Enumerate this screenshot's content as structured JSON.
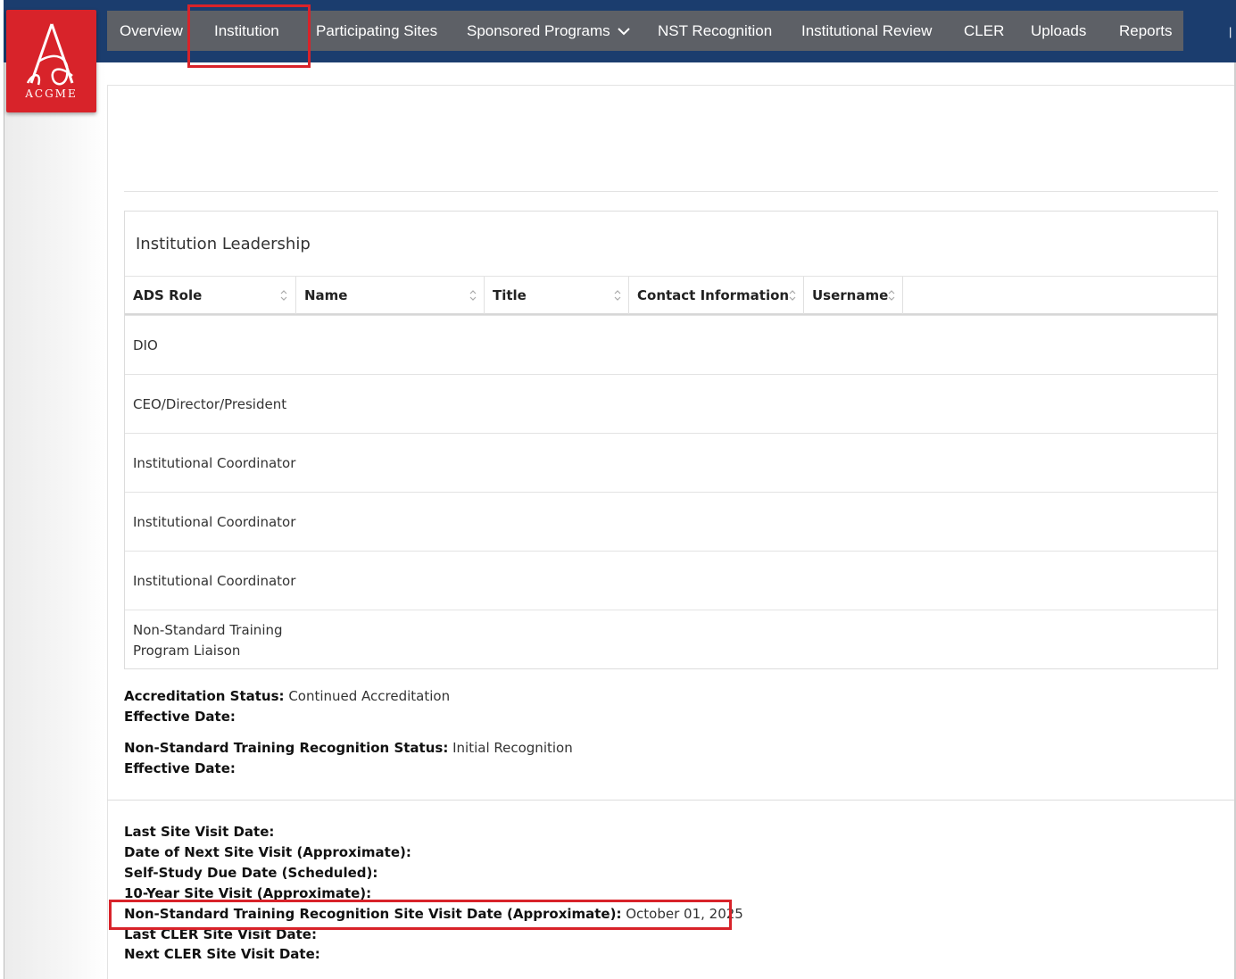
{
  "app": {
    "logo_text": "ACGME"
  },
  "nav": {
    "items": [
      {
        "label": "Overview"
      },
      {
        "label": "Institution"
      },
      {
        "label": "Participating Sites"
      },
      {
        "label": "Sponsored Programs"
      },
      {
        "label": "NST Recognition"
      },
      {
        "label": "Institutional Review"
      },
      {
        "label": "CLER"
      },
      {
        "label": "Uploads"
      },
      {
        "label": "Reports"
      }
    ],
    "active": "Institution"
  },
  "leadership": {
    "title": "Institution Leadership",
    "columns": [
      "ADS Role",
      "Name",
      "Title",
      "Contact Information",
      "Username"
    ],
    "rows": [
      {
        "role": "DIO"
      },
      {
        "role": "CEO/Director/President"
      },
      {
        "role": "Institutional Coordinator"
      },
      {
        "role": "Institutional Coordinator"
      },
      {
        "role": "Institutional Coordinator"
      },
      {
        "role": "Non-Standard Training Program Liaison"
      }
    ]
  },
  "status": {
    "accreditation_label": "Accreditation Status:",
    "accreditation_value": "Continued Accreditation",
    "effective_label": "Effective Date:",
    "nst_label": "Non-Standard Training Recognition Status:",
    "nst_value": "Initial Recognition",
    "nst_effective_label": "Effective Date:"
  },
  "visits": {
    "last_site_visit": "Last Site Visit Date:",
    "next_site_visit": "Date of Next Site Visit (Approximate):",
    "self_study": "Self-Study Due Date (Scheduled):",
    "ten_year": "10-Year Site Visit (Approximate):",
    "nst_visit_label": "Non-Standard Training Recognition Site Visit Date (Approximate):",
    "nst_visit_value": "October 01, 2025",
    "last_cler": "Last CLER Site Visit Date:",
    "next_cler": "Next CLER Site Visit Date:"
  },
  "colors": {
    "nav_bg": "#5d6066",
    "topbar": "#1b3d6e",
    "brand_red": "#d8232a"
  }
}
